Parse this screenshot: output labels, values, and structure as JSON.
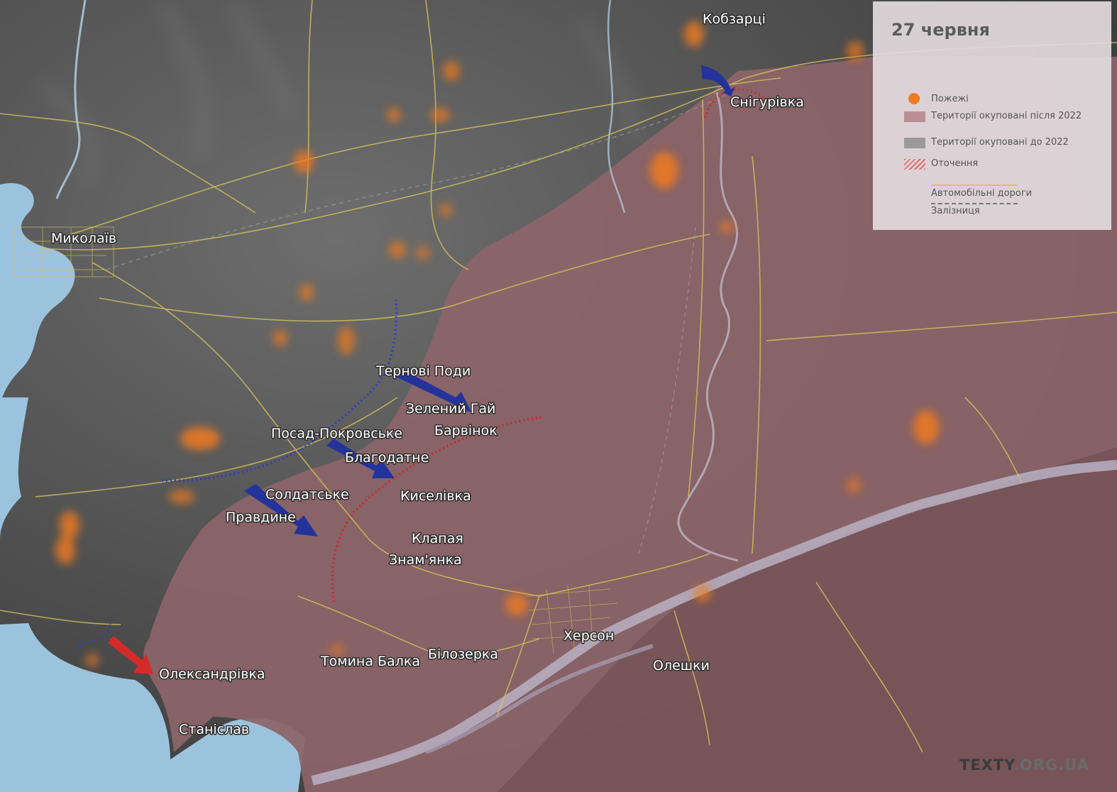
{
  "date": "27 червня",
  "legend": {
    "fires": "Пожежі",
    "occupied_after_2022": "Території окуповані після 2022",
    "occupied_before_2022": "Території окуповані до 2022",
    "encirclement": "Оточення",
    "roads": "Автомобільні дороги",
    "railway": "Залізниця"
  },
  "places": {
    "kobzartsi": "Кобзарці",
    "snihurivka": "Снігурівка",
    "mykolaiv": "Миколаїв",
    "ternovi_pody": "Тернові Поди",
    "zelenyi_hai": "Зелений Гай",
    "barvinok": "Барвінок",
    "posad_pokrovske": "Посад-Покровське",
    "blahodatne": "Благодатне",
    "soldatske": "Солдатське",
    "kyselivka": "Киселівка",
    "pravdyne": "Правдине",
    "klapaia": "Клапая",
    "znamianka": "Знам'янка",
    "kherson": "Херсон",
    "bilozerka": "Білозерка",
    "tomyna_balka": "Томина Балка",
    "oleshky": "Олешки",
    "oleksandrivka": "Олександрівка",
    "stanislav": "Станіслав"
  },
  "colors": {
    "occupied_after_2022": "#8c6468",
    "occupied_before_2022": "#5a5a5a",
    "fire": "#f07a1e",
    "ukraine_advance": "#1f2f9e",
    "russia_advance": "#d52a2a",
    "road": "#d8c25a",
    "water": "#9cc3dd"
  },
  "watermark": {
    "main": "TEXTY",
    "suffix": ".ORG.UA"
  }
}
